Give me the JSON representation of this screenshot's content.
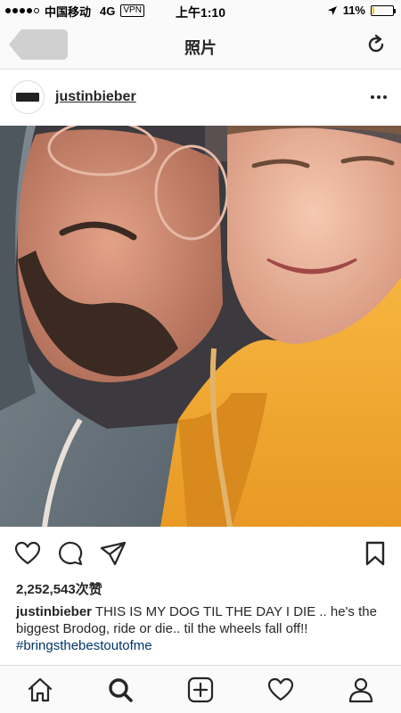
{
  "status_bar": {
    "carrier": "中国移动",
    "network": "4G",
    "vpn": "VPN",
    "time": "上午1:10",
    "battery": "11%",
    "battery_level": 0.11
  },
  "nav": {
    "title": "照片"
  },
  "post": {
    "username": "justinbieber",
    "likes": "2,252,543次赞",
    "caption_user": "justinbieber",
    "caption_text": " THIS IS MY DOG TIL THE DAY I DIE .. he's the biggest Brodog, ride or die.. til the wheels fall off!! ",
    "hashtag": "#bringsthebestoutofme",
    "comments_peek": " "
  },
  "icons": {
    "back": "back-arrow-icon",
    "refresh": "refresh-icon",
    "more": "more-options-icon",
    "like": "heart-icon",
    "comment": "comment-icon",
    "share": "paper-plane-icon",
    "save": "bookmark-icon",
    "tabs": [
      "home-icon",
      "search-icon",
      "add-post-icon",
      "activity-heart-icon",
      "profile-icon"
    ]
  },
  "colors": {
    "hashtag": "#003569",
    "battery": "#f4c300",
    "hoodie_orange": "#f0a830",
    "hoodie_grey": "#6e7a80"
  }
}
